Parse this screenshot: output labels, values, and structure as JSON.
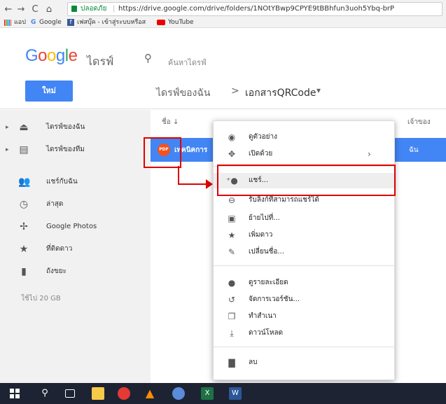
{
  "browser": {
    "back": "←",
    "forward": "→",
    "reload": "C",
    "home": "⌂",
    "secure_label": "ปลอดภัย",
    "url": "https://drive.google.com/drive/folders/1NOtYBwp9CPYE9tBBhfun3uoh5Ybq-brP",
    "bookmarks": {
      "apps": "แอป",
      "google": "Google",
      "facebook": "เฟสบุ๊ค - เข้าสู่ระบบหรือส",
      "youtube": "YouTube"
    }
  },
  "header": {
    "logo": "Google",
    "product": "ไดรฟ์",
    "search_placeholder": "ค้นหาไดรฟ์"
  },
  "subheader": {
    "new_button": "ใหม่",
    "breadcrumb_root": "ไดรฟ์ของฉัน",
    "breadcrumb_sep": ">",
    "breadcrumb_current": "เอกสารQRCode",
    "dropdown": "▾"
  },
  "sidebar": {
    "items": [
      {
        "label": "ไดรฟ์ของฉัน"
      },
      {
        "label": "ไดรฟ์ของทีม"
      },
      {
        "label": "แชร์กับฉัน"
      },
      {
        "label": "ล่าสุด"
      },
      {
        "label": "Google Photos"
      },
      {
        "label": "ที่ติดดาว"
      },
      {
        "label": "ถังขยะ"
      }
    ],
    "storage": "ใช้ไป 20 GB"
  },
  "list": {
    "col_name": "ชื่อ ↓",
    "col_owner": "เจ้าของ",
    "row_name": "เทคนิคการ",
    "row_owner": "ฉัน",
    "file_badge": "PDF"
  },
  "context_menu": {
    "items": [
      {
        "icon": "eye-icon",
        "glyph": "◉",
        "label": "ดูตัวอย่าง"
      },
      {
        "icon": "move-arrows-icon",
        "glyph": "✥",
        "label": "เปิดด้วย",
        "arrow": "›"
      },
      {
        "icon": "add-person-icon",
        "glyph": "⁺●",
        "label": "แชร์..."
      },
      {
        "icon": "link-icon",
        "glyph": "⊖",
        "label": "รับลิงก์ที่สามารถแชร์ได้"
      },
      {
        "icon": "move-folder-icon",
        "glyph": "▣",
        "label": "ย้ายไปที่..."
      },
      {
        "icon": "star-icon",
        "glyph": "★",
        "label": "เพิ่มดาว"
      },
      {
        "icon": "edit-icon",
        "glyph": "✎",
        "label": "เปลี่ยนชื่อ..."
      },
      {
        "icon": "info-icon",
        "glyph": "●",
        "label": "ดูรายละเอียด"
      },
      {
        "icon": "history-icon",
        "glyph": "↺",
        "label": "จัดการเวอร์ชัน..."
      },
      {
        "icon": "copy-icon",
        "glyph": "❐",
        "label": "ทำสำเนา"
      },
      {
        "icon": "download-icon",
        "glyph": "⤓",
        "label": "ดาวน์โหลด"
      },
      {
        "icon": "trash-icon",
        "glyph": "▇",
        "label": "ลบ"
      }
    ]
  },
  "colors": {
    "accent": "#4285f4",
    "highlight_box": "#e00000"
  },
  "taskbar": {
    "word_label": "W",
    "excel_label": "X"
  }
}
